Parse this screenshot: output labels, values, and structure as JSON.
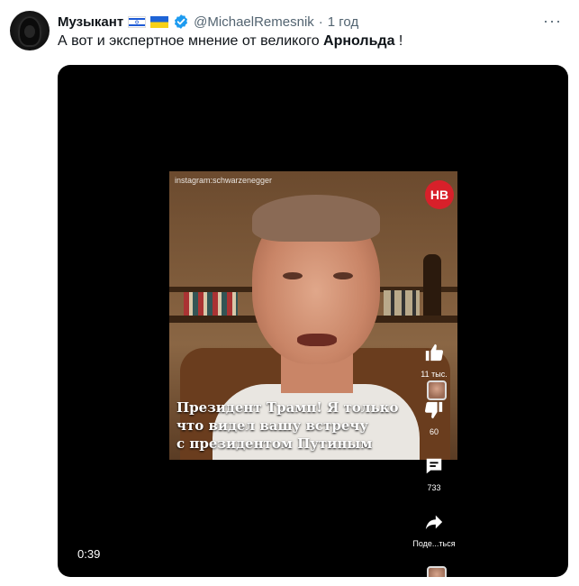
{
  "tweet": {
    "display_name": "Музыкант",
    "handle": "@MichaelRemesnik",
    "separator": "·",
    "time": "1 год",
    "more_label": "···",
    "text_before": "А вот и экспертное мнение от великого ",
    "text_bold": "Арнольда",
    "text_after": " !"
  },
  "video": {
    "watermark": "instagram:schwarzenegger",
    "channel_logo": "НВ",
    "caption_lines": [
      "Президент Трамп! Я только",
      "что видел вашу встречу",
      "с президентом Путиным"
    ],
    "like_count": "11 тыс.",
    "dislike_count": "60",
    "comment_count": "733",
    "share_label": "Поде...ться",
    "duration": "0:39"
  },
  "icons": {
    "like": "thumb-up-icon",
    "dislike": "thumb-down-icon",
    "comment": "comment-icon",
    "share": "share-arrow-icon",
    "verified": "verified-badge-icon"
  },
  "colors": {
    "text_primary": "#0f1419",
    "text_secondary": "#536471",
    "verified_blue": "#1d9bf0",
    "video_background": "#000000",
    "channel_red": "#d8202a"
  }
}
